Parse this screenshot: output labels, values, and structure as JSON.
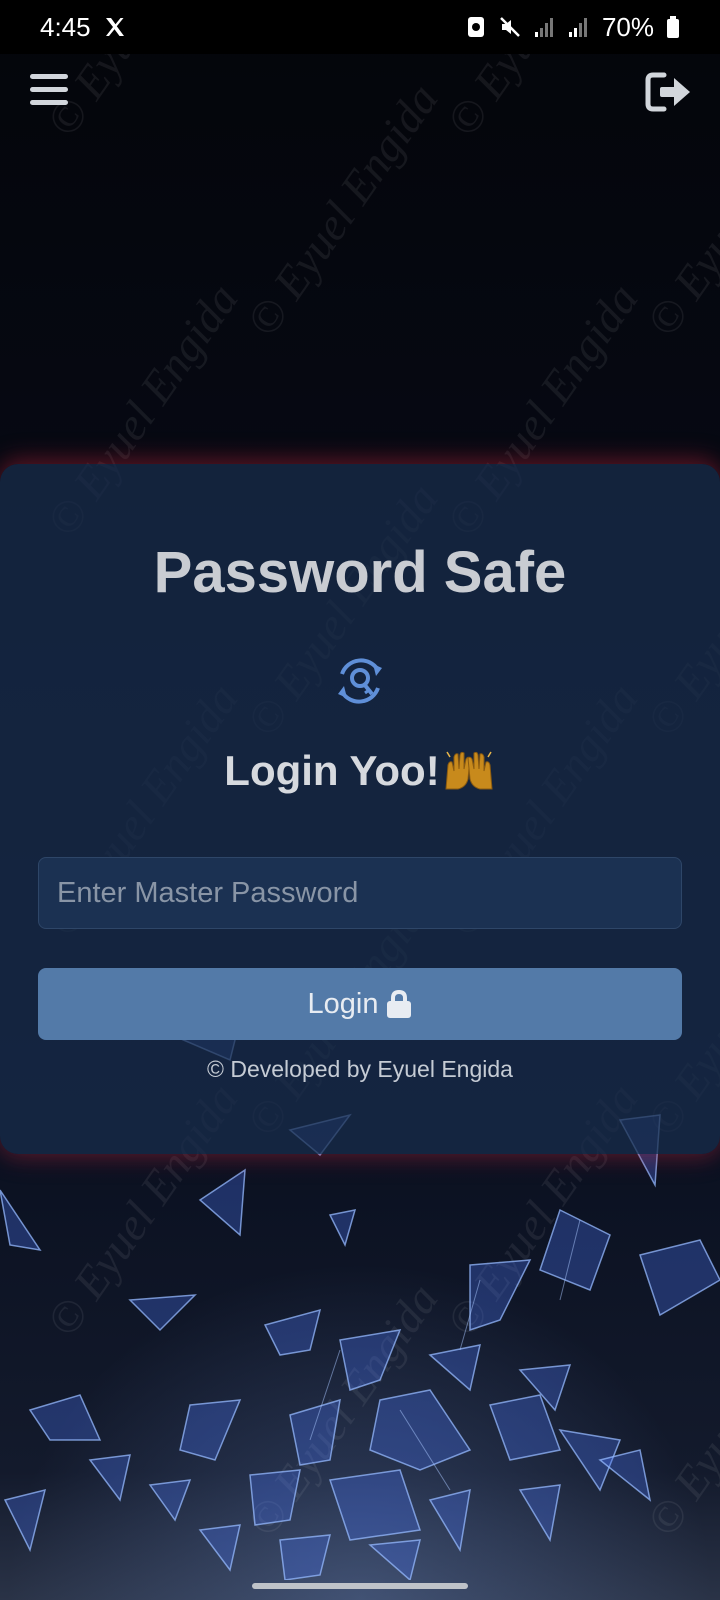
{
  "status_bar": {
    "time": "4:45",
    "x_app_icon": "x-logo-icon",
    "battery_percent": "70%",
    "icons": [
      "recycle-icon",
      "mute-icon",
      "signal-icon",
      "signal-icon",
      "battery-icon"
    ]
  },
  "top_bar": {
    "menu_icon": "hamburger-menu-icon",
    "logout_icon": "sign-out-icon"
  },
  "watermark": {
    "text": "© Eyuel Engida"
  },
  "login_card": {
    "title": "Password Safe",
    "key_icon": "key-rotate-icon",
    "subtitle": "Login Yoo!",
    "subtitle_emoji": "raising-hands-icon",
    "password_placeholder": "Enter Master Password",
    "password_value": "",
    "login_button_label": "Login",
    "login_button_icon": "lock-icon",
    "credit": "© Developed by Eyuel Engida"
  },
  "colors": {
    "card_bg": "#182c4c",
    "button_bg": "#537aa8",
    "input_bg": "#1b3152",
    "accent_blue": "#5f8fd8",
    "card_glow": "#c8283c",
    "title_text": "#c9ccd2"
  }
}
